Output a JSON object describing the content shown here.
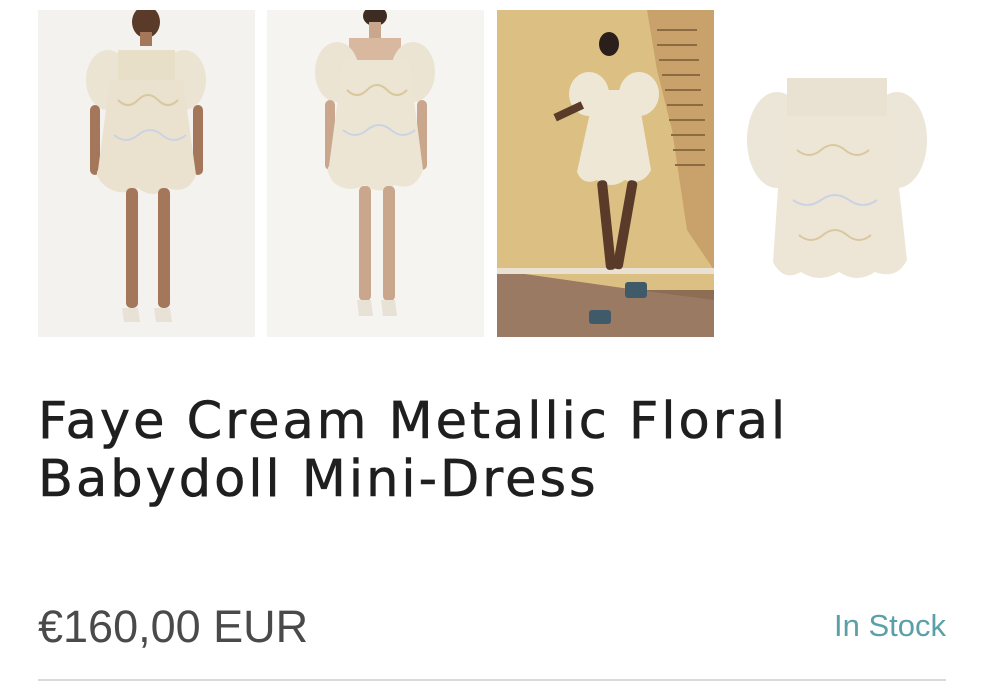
{
  "gallery": {
    "images": [
      {
        "alt": "front-view"
      },
      {
        "alt": "back-view"
      },
      {
        "alt": "editorial-view"
      },
      {
        "alt": "flat-lay-view"
      }
    ]
  },
  "product": {
    "title": "Faye Cream Metallic Floral Babydoll Mini-Dress",
    "price": "€160,00 EUR",
    "stock_status": "In Stock"
  },
  "colors": {
    "title_text": "#1f1f1f",
    "price_text": "#4a4a4a",
    "stock_text": "#5aa0a6",
    "divider": "#d9d9d9"
  }
}
